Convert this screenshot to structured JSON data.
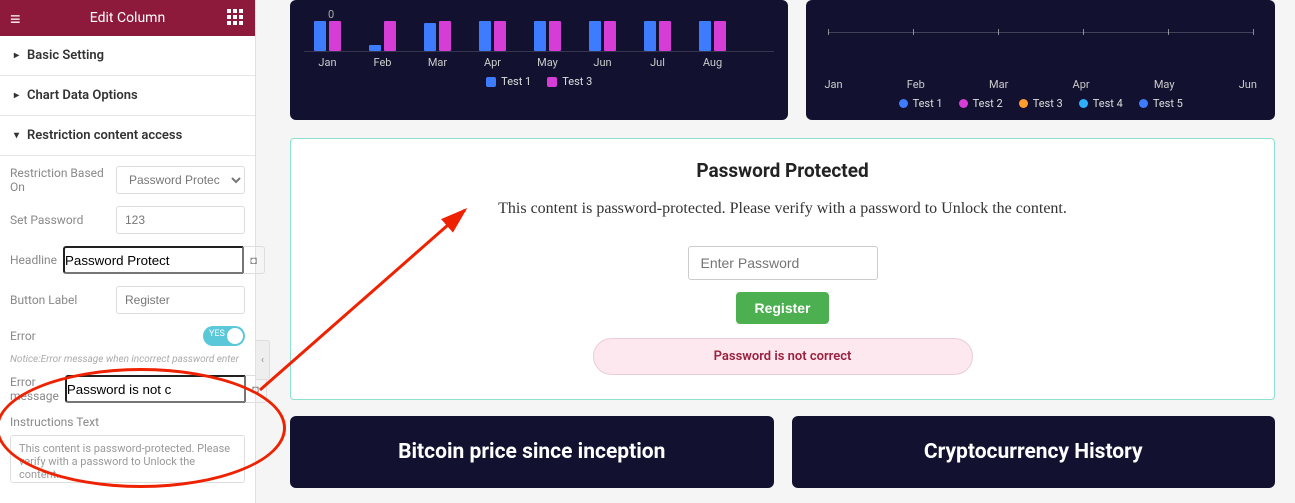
{
  "sidebar": {
    "title": "Edit Column",
    "sections": {
      "basic": "Basic Setting",
      "chartData": "Chart Data Options",
      "restriction": "Restriction content access"
    },
    "fields": {
      "restrictionBasedOn": {
        "label": "Restriction Based On",
        "value": "Password Protected"
      },
      "setPassword": {
        "label": "Set Password",
        "value": "123"
      },
      "headline": {
        "label": "Headline",
        "value": "Password Protect"
      },
      "buttonLabel": {
        "label": "Button Label",
        "value": "Register"
      },
      "error": {
        "label": "Error",
        "toggle": "YES"
      },
      "notice": "Notice:Error message when incorrect password enter",
      "errorMessage": {
        "label": "Error message",
        "value": "Password is not c"
      },
      "instructions": {
        "label": "Instructions Text",
        "value": "This content is password-protected. Please verify with a password to Unlock the content."
      }
    }
  },
  "passwordCard": {
    "title": "Password Protected",
    "desc": "This content is password-protected. Please verify with a password to Unlock the content.",
    "placeholder": "Enter Password",
    "button": "Register",
    "error": "Password is not correct"
  },
  "bottom": {
    "left": "Bitcoin price since inception",
    "right": "Cryptocurrency History"
  },
  "chart_data": [
    {
      "type": "bar",
      "categories": [
        "Jan",
        "Feb",
        "Mar",
        "Apr",
        "May",
        "Jun",
        "Jul",
        "Aug"
      ],
      "series": [
        {
          "name": "Test 1",
          "color": "#3d7cff",
          "values": [
            30,
            6,
            28,
            30,
            30,
            30,
            30,
            30
          ]
        },
        {
          "name": "Test 3",
          "color": "#d63cd6",
          "values": [
            30,
            30,
            30,
            30,
            30,
            30,
            30,
            30
          ]
        }
      ],
      "ylim": [
        0,
        40
      ]
    },
    {
      "type": "line",
      "categories": [
        "Jan",
        "Feb",
        "Mar",
        "Apr",
        "May",
        "Jun"
      ],
      "series": [
        {
          "name": "Test 1",
          "color": "#3d7cff"
        },
        {
          "name": "Test 2",
          "color": "#d63cd6"
        },
        {
          "name": "Test 3",
          "color": "#ff9d2e"
        },
        {
          "name": "Test 4",
          "color": "#2eb0ff"
        },
        {
          "name": "Test 5",
          "color": "#3d7cff"
        }
      ]
    }
  ]
}
